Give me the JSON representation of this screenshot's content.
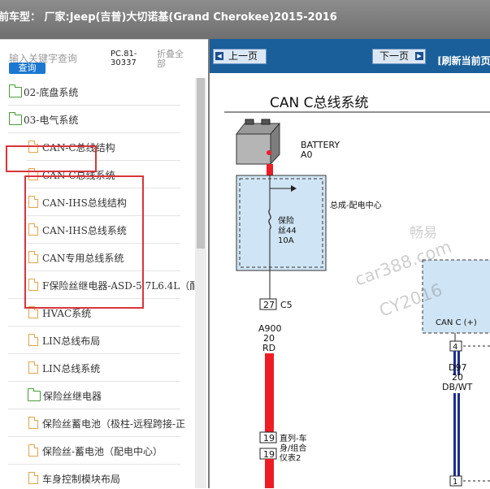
{
  "window": {
    "title": "前车型：  厂家:Jeep(吉普)大切诺基(Grand Cherokee)2015-2016"
  },
  "sidebar": {
    "search_placeholder": "输入关键字查询",
    "search_button": "查询",
    "doc_code_line1": "PC.81-",
    "doc_code_line2": "30337",
    "fold_line1": "折叠全",
    "fold_line2": "部",
    "items": [
      {
        "label": "02-底盘系统",
        "icon": "folder-icon"
      },
      {
        "label": "03-电气系统",
        "icon": "folder-open-icon"
      },
      {
        "label": "CAN-C总线结构",
        "icon": "document-icon"
      },
      {
        "label": "CAN-C总线系统",
        "icon": "document-icon"
      },
      {
        "label": "CAN-IHS总线结构",
        "icon": "document-icon"
      },
      {
        "label": "CAN-IHS总线系统",
        "icon": "document-icon"
      },
      {
        "label": "CAN专用总线系统",
        "icon": "document-icon"
      },
      {
        "label": "F保险丝继电器-ASD-5.7L6.4L（配",
        "icon": "document-icon"
      },
      {
        "label": "HVAC系统",
        "icon": "document-icon"
      },
      {
        "label": "LIN总线布局",
        "icon": "document-icon"
      },
      {
        "label": "LIN总线系统",
        "icon": "document-icon"
      },
      {
        "label": "保险丝继电器",
        "icon": "folder-icon"
      },
      {
        "label": "保险丝蓄电池（极柱-远程跨接-正",
        "icon": "document-icon"
      },
      {
        "label": "保险丝-蓄电池（配电中心）",
        "icon": "document-icon"
      },
      {
        "label": "车身控制模块布局",
        "icon": "document-icon"
      }
    ]
  },
  "viewer": {
    "prev_button": "上一页",
    "next_button": "下一页",
    "refresh_label": "[刷新当前页"
  },
  "diagram": {
    "title": "CAN C总线系统",
    "battery_label": "BATTERY",
    "battery_code": "A0",
    "pdc_label": "总成-配电中心",
    "fuse_label_1": "保险",
    "fuse_label_2": "丝44",
    "fuse_rating": "10A",
    "pin_27": "27",
    "connector_c5": "C5",
    "wire_code": "A900",
    "wire_gauge": "20",
    "wire_color": "RD",
    "pin_19a": "19",
    "pin_19b": "19",
    "ipc_label_1": "直列-车",
    "ipc_label_2": "身/组合",
    "ipc_label_3": "仪表2",
    "can_module_label": "CAN C (+)",
    "pin_4": "4",
    "wire2_code": "D97",
    "wire2_gauge": "20",
    "wire2_color": "DB/WT",
    "pin_1": "1",
    "watermark_1": "畅易",
    "watermark_2": "car388.com",
    "watermark_3": "CY2016"
  },
  "colors": {
    "highlight": "#d8353a",
    "viewer_bar": "#1a5f9a",
    "wire_red": "#ee1c25",
    "wire_blue": "#1d2f8c",
    "box_fill": "#cfe4f4"
  }
}
